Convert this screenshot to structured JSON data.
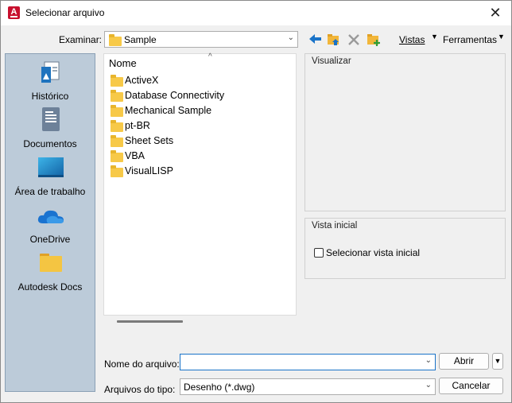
{
  "window": {
    "title": "Selecionar arquivo",
    "close_glyph": "✕",
    "app_icon_letter": "A"
  },
  "toolbar": {
    "look_in_label": "Examinar:",
    "look_in_value": "Sample",
    "views_label": "Vistas",
    "tools_label": "Ferramentas",
    "icons": [
      "back-arrow-icon",
      "up-folder-icon",
      "delete-icon",
      "new-folder-icon"
    ]
  },
  "places": [
    {
      "label": "Histórico",
      "icon": "history-icon"
    },
    {
      "label": "Documentos",
      "icon": "documents-icon"
    },
    {
      "label": "Área de trabalho",
      "icon": "desktop-icon"
    },
    {
      "label": "OneDrive",
      "icon": "onedrive-cloud-icon"
    },
    {
      "label": "Autodesk Docs",
      "icon": "folder-icon"
    }
  ],
  "filelist": {
    "column_header": "Nome",
    "items": [
      "ActiveX",
      "Database Connectivity",
      "Mechanical Sample",
      "pt-BR",
      "Sheet Sets",
      "VBA",
      "VisualLISP"
    ]
  },
  "preview": {
    "title": "Visualizar"
  },
  "initial_view": {
    "title": "Vista inicial",
    "checkbox_label": "Selecionar vista inicial",
    "checked": false
  },
  "footer": {
    "filename_label": "Nome do arquivo:",
    "filename_value": "",
    "filetype_label": "Arquivos do tipo:",
    "filetype_value": "Desenho (*.dwg)",
    "open_label": "Abrir",
    "cancel_label": "Cancelar"
  }
}
